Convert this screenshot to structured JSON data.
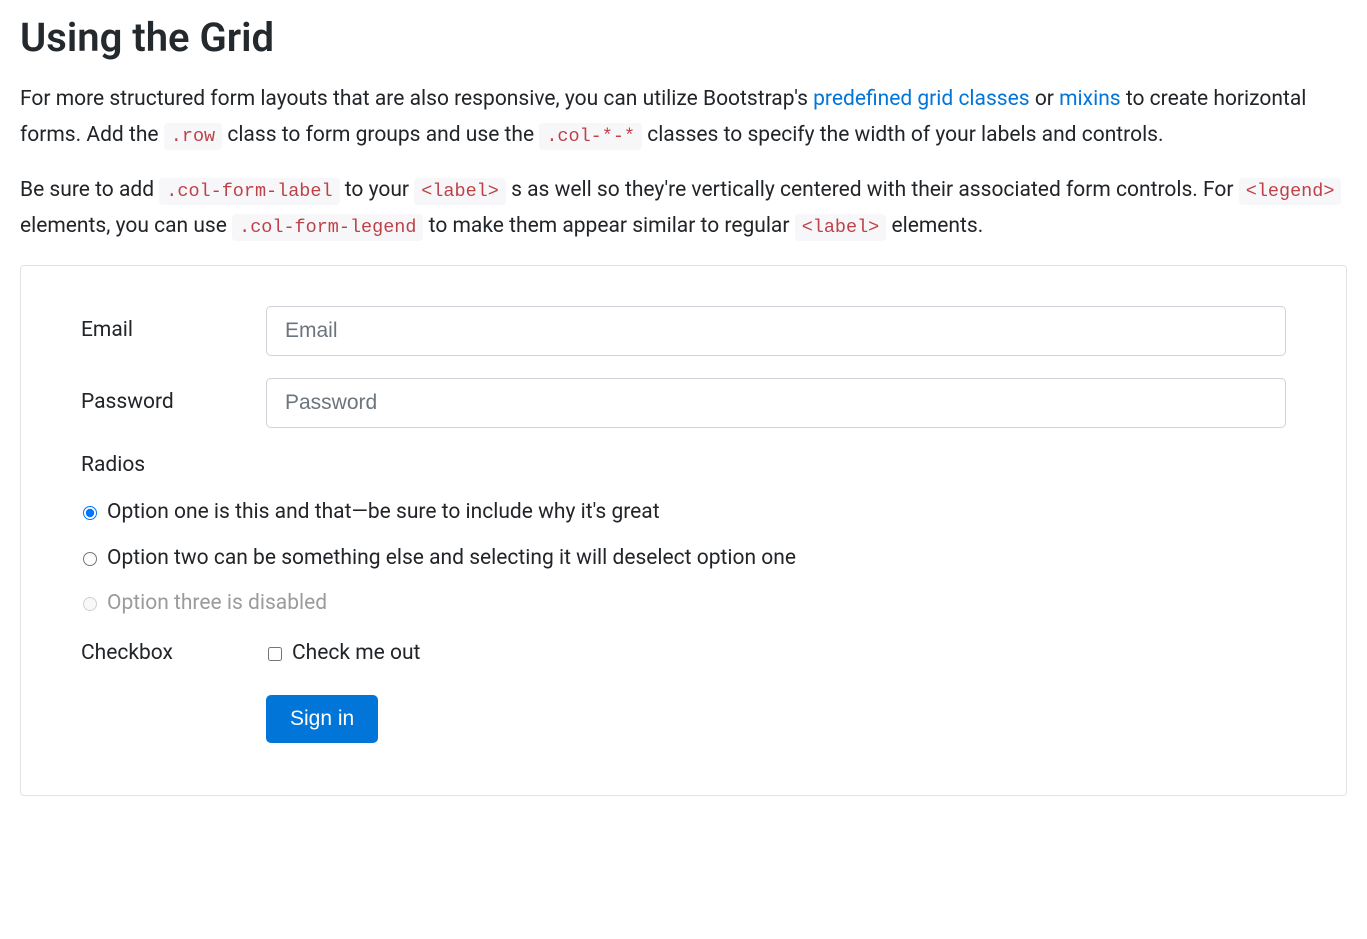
{
  "heading": "Using the Grid",
  "para1": {
    "t1": "For more structured form layouts that are also responsive, you can utilize Bootstrap's ",
    "link1": "predefined grid classes",
    "t2": " or ",
    "link2": "mixins",
    "t3": " to create horizontal forms. Add the ",
    "code1": ".row",
    "t4": " class to form groups and use the ",
    "code2": ".col-*-*",
    "t5": " classes to specify the width of your labels and controls."
  },
  "para2": {
    "t1": "Be sure to add ",
    "code1": ".col-form-label",
    "t2": " to your ",
    "code2": "<label>",
    "t3": " s as well so they're vertically centered with their associated form controls. For ",
    "code3": "<legend>",
    "t4": " elements, you can use ",
    "code4": ".col-form-legend",
    "t5": " to make them appear similar to regular ",
    "code5": "<label>",
    "t6": " elements."
  },
  "form": {
    "email_label": "Email",
    "email_placeholder": "Email",
    "password_label": "Password",
    "password_placeholder": "Password",
    "radios_legend": "Radios",
    "radio1": "Option one is this and that—be sure to include why it's great",
    "radio2": "Option two can be something else and selecting it will deselect option one",
    "radio3": "Option three is disabled",
    "checkbox_label": "Checkbox",
    "checkbox_text": "Check me out",
    "submit": "Sign in"
  }
}
